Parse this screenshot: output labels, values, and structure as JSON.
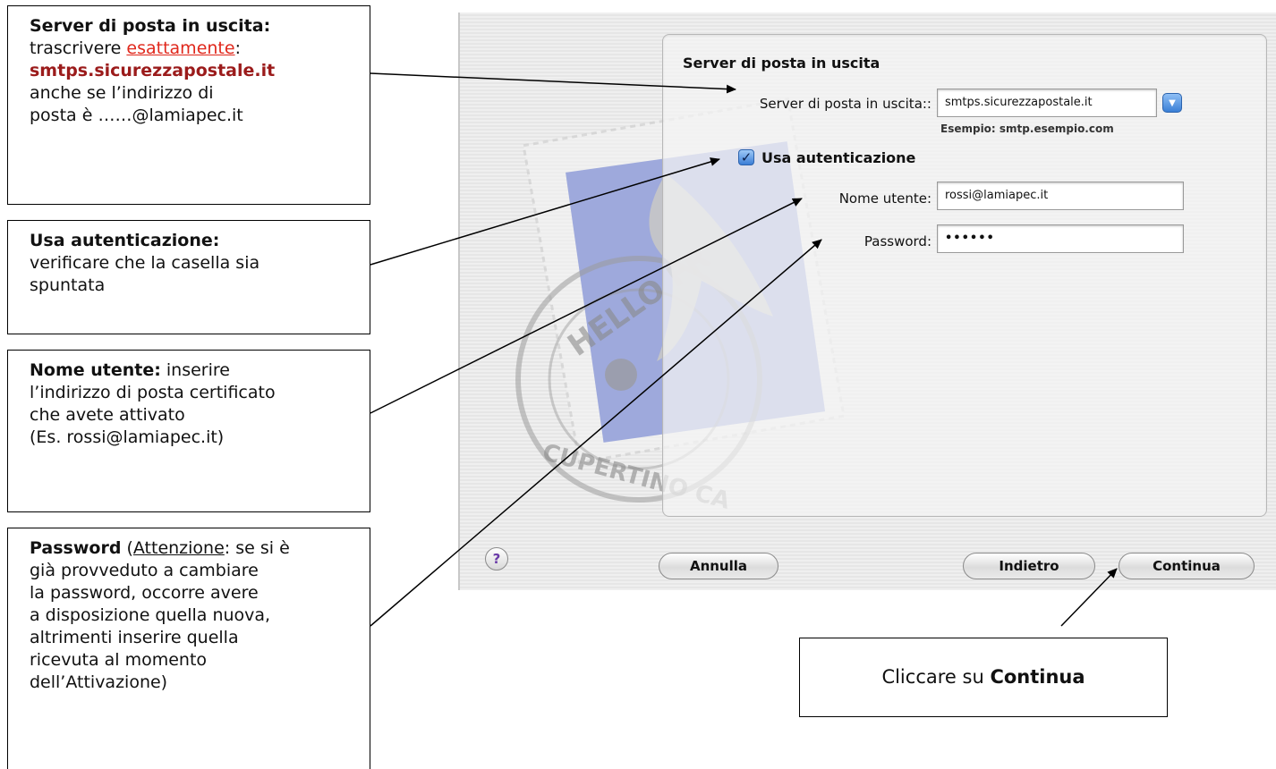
{
  "notes": {
    "server": {
      "title": "Server di posta in uscita",
      "line1_pre": "trascrivere ",
      "line1_link": "esattamente",
      "line1_post": ":",
      "host": "smtps.sicurezzapostale.it",
      "line3": "anche se l’indirizzo di",
      "line4": "posta è ……@lamiapec.it"
    },
    "auth": {
      "title": "Usa autenticazione",
      "line1": "verificare che la casella sia",
      "line2": "spuntata"
    },
    "user": {
      "title": "Nome utente",
      "title_post": " inserire",
      "line1": "l’indirizzo di posta certificato",
      "line2": "che avete attivato",
      "line3": "(Es. rossi@lamiapec.it)"
    },
    "password": {
      "title": "Password",
      "paren_open": " (",
      "attention": "Attenzione",
      "line0_post": ": se si è",
      "line1": "già provveduto a cambiare",
      "line2": "la password, occorre avere",
      "line3": "a disposizione quella nuova,",
      "line4": "altrimenti inserire quella",
      "line5": "ricevuta al momento",
      "line6": "dell’Attivazione)"
    },
    "continue": {
      "pre": "Cliccare su ",
      "bold": "Continua"
    }
  },
  "dialog": {
    "section_title": "Server di posta in uscita",
    "outgoing_label": "Server di posta in uscita::",
    "outgoing_value": "smtps.sicurezzapostale.it",
    "example_hint": "Esempio: smtp.esempio.com",
    "use_auth_label": "Usa autenticazione",
    "use_auth_checked": true,
    "username_label": "Nome utente:",
    "username_value": "rossi@lamiapec.it",
    "password_label": "Password:",
    "password_mask": "••••••",
    "buttons": {
      "help": "?",
      "cancel": "Annulla",
      "back": "Indietro",
      "continue": "Continua"
    },
    "stamp_text_top": "HELLO FR",
    "stamp_text_bottom": "CUPERTINO CA"
  },
  "colors": {
    "dark_red": "#9b1b1b",
    "link_red": "#e0281c",
    "aqua_blue": "#3a7fd6",
    "stamp_blue": "#8f9cd8"
  }
}
